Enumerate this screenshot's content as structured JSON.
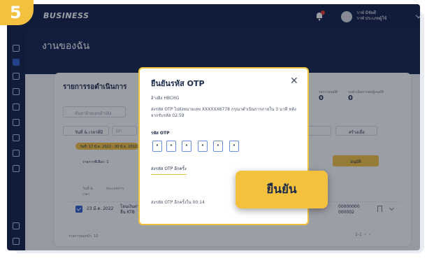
{
  "step": {
    "number": "5"
  },
  "topbar": {
    "logo": "BUSINESS",
    "user_line1": "วาฬ มิชัยดี",
    "user_line2": "วาฬ ประเภทผู้ใช้"
  },
  "page": {
    "title": "งานของฉัน"
  },
  "card": {
    "title": "รายการรอดำเนินการ",
    "stat1_label": "รอการอนุมัติ",
    "stat1_value": "0",
    "stat2_label": "รอดำเนินการต่อผู้อนุมัติ",
    "stat2_value": "0",
    "search_placeholder": "ค้นหาด้วยเลขอ้างอิง",
    "date_button": "วันที่ & เวลาที่มี",
    "u_button": "Un",
    "create_button": "สร้างเมื่อ",
    "date_chip": "วันที่: 17 มี.ค. 2022 - 30 มี.ค. 2022",
    "selected_count": "รายการที่เลือก: 1",
    "approve_button": "อนุมัติ",
    "columns": [
      "วันที่ &",
      "ประเภทการ"
    ],
    "col_second_line": "เวลา",
    "row": {
      "date": "23 มี.ค. 2022",
      "type": "โอนเงินต่างธนาคาร",
      "type2": "อื่น KTB",
      "ref": "00000000",
      "ref2": "000002"
    },
    "footer_left": "รายการต่อหน้า: 10",
    "footer_right": "1-1"
  },
  "modal": {
    "title": "ยืนยันรหัส OTP",
    "close": "✕",
    "ref": "อ้างอิง HBCHG",
    "desc": "ส่งรหัส OTP ไปยังหมายเลข XXXXXX6778 กรุณาดำเนินการภายใน 3 นาที หลังจากรับรหัส 02:59",
    "otp_label": "รหัส OTP",
    "otp_digits": [
      "•",
      "•",
      "•",
      "•",
      "•",
      "•"
    ],
    "resend": "ส่งรหัส OTP อีกครั้ง",
    "timer": "ส่งรหัส OTP อีกครั้งใน 00:14"
  },
  "confirm_button": "ยืนยัน",
  "colors": {
    "navy": "#0f1f48",
    "accent": "#f4c13e",
    "otp_border": "#6a8fe0"
  }
}
